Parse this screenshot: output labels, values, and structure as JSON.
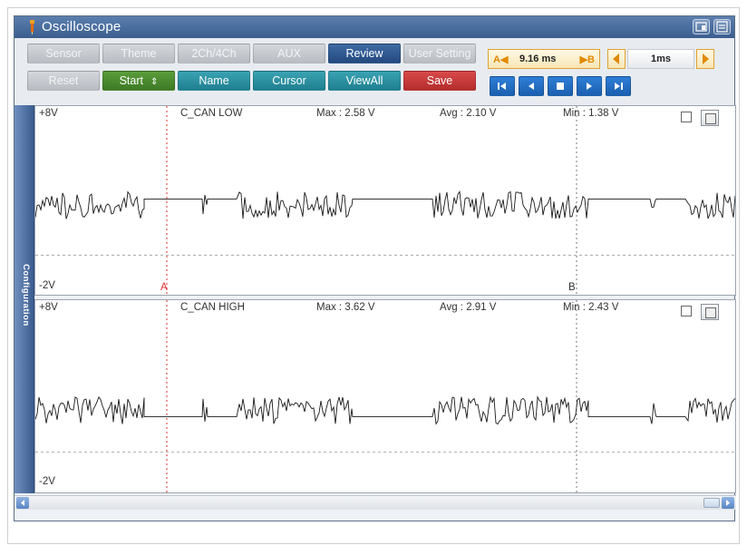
{
  "window": {
    "title": "Oscilloscope"
  },
  "toolbar": {
    "row1": [
      {
        "label": "Sensor",
        "style": "gray"
      },
      {
        "label": "Theme",
        "style": "gray"
      },
      {
        "label": "2Ch/4Ch",
        "style": "gray"
      },
      {
        "label": "AUX",
        "style": "gray"
      },
      {
        "label": "Review",
        "style": "blue"
      },
      {
        "label": "User Setting",
        "style": "gray"
      }
    ],
    "row2": [
      {
        "label": "Reset",
        "style": "gray"
      },
      {
        "label": "Start",
        "style": "green",
        "suffix": "⇕"
      },
      {
        "label": "Name",
        "style": "teal"
      },
      {
        "label": "Cursor",
        "style": "teal"
      },
      {
        "label": "ViewAll",
        "style": "teal"
      },
      {
        "label": "Save",
        "style": "red"
      }
    ],
    "cursor": {
      "a_label": "A◀",
      "value": "9.16 ms",
      "b_label": "▶B"
    },
    "time_div": {
      "value": "1ms",
      "left_icon": "arrow-left-icon",
      "right_icon": "arrow-right-icon"
    },
    "playback": [
      "skip-first-icon",
      "step-back-icon",
      "stop-icon",
      "play-icon",
      "skip-last-icon"
    ]
  },
  "sidebar": {
    "label": "Configuration"
  },
  "channels": [
    {
      "name": "C_CAN LOW",
      "top_label": "+8V",
      "bottom_label": "-2V",
      "max": "Max : 2.58 V",
      "avg": "Avg : 2.10 V",
      "min": "Min : 1.38 V",
      "cursor_a": "A",
      "cursor_b": "B"
    },
    {
      "name": "C_CAN HIGH",
      "top_label": "+8V",
      "bottom_label": "-2V",
      "max": "Max : 3.62 V",
      "avg": "Avg : 2.91 V",
      "min": "Min : 2.43 V",
      "cursor_a": "",
      "cursor_b": ""
    }
  ],
  "colors": {
    "accent": "#2f5a92",
    "cursor": "#e03030",
    "trace": "#1a1a1a"
  }
}
